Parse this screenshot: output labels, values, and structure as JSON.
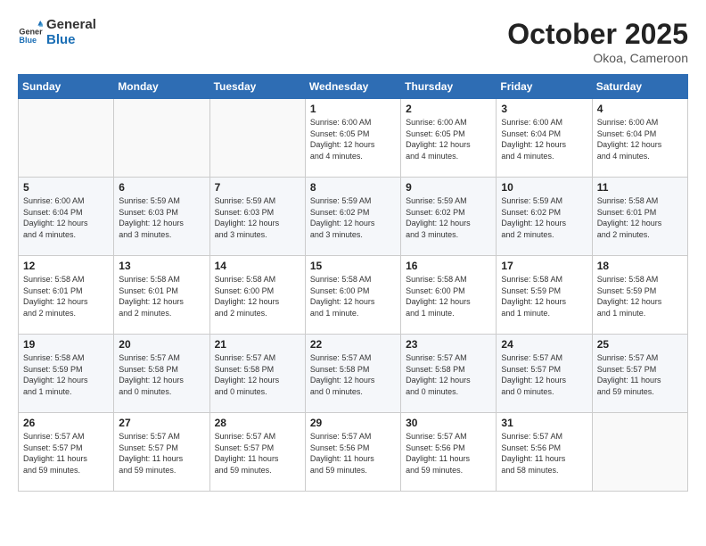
{
  "header": {
    "logo_line1": "General",
    "logo_line2": "Blue",
    "month_year": "October 2025",
    "location": "Okoa, Cameroon"
  },
  "weekdays": [
    "Sunday",
    "Monday",
    "Tuesday",
    "Wednesday",
    "Thursday",
    "Friday",
    "Saturday"
  ],
  "weeks": [
    [
      {
        "day": "",
        "info": ""
      },
      {
        "day": "",
        "info": ""
      },
      {
        "day": "",
        "info": ""
      },
      {
        "day": "1",
        "info": "Sunrise: 6:00 AM\nSunset: 6:05 PM\nDaylight: 12 hours\nand 4 minutes."
      },
      {
        "day": "2",
        "info": "Sunrise: 6:00 AM\nSunset: 6:05 PM\nDaylight: 12 hours\nand 4 minutes."
      },
      {
        "day": "3",
        "info": "Sunrise: 6:00 AM\nSunset: 6:04 PM\nDaylight: 12 hours\nand 4 minutes."
      },
      {
        "day": "4",
        "info": "Sunrise: 6:00 AM\nSunset: 6:04 PM\nDaylight: 12 hours\nand 4 minutes."
      }
    ],
    [
      {
        "day": "5",
        "info": "Sunrise: 6:00 AM\nSunset: 6:04 PM\nDaylight: 12 hours\nand 4 minutes."
      },
      {
        "day": "6",
        "info": "Sunrise: 5:59 AM\nSunset: 6:03 PM\nDaylight: 12 hours\nand 3 minutes."
      },
      {
        "day": "7",
        "info": "Sunrise: 5:59 AM\nSunset: 6:03 PM\nDaylight: 12 hours\nand 3 minutes."
      },
      {
        "day": "8",
        "info": "Sunrise: 5:59 AM\nSunset: 6:02 PM\nDaylight: 12 hours\nand 3 minutes."
      },
      {
        "day": "9",
        "info": "Sunrise: 5:59 AM\nSunset: 6:02 PM\nDaylight: 12 hours\nand 3 minutes."
      },
      {
        "day": "10",
        "info": "Sunrise: 5:59 AM\nSunset: 6:02 PM\nDaylight: 12 hours\nand 2 minutes."
      },
      {
        "day": "11",
        "info": "Sunrise: 5:58 AM\nSunset: 6:01 PM\nDaylight: 12 hours\nand 2 minutes."
      }
    ],
    [
      {
        "day": "12",
        "info": "Sunrise: 5:58 AM\nSunset: 6:01 PM\nDaylight: 12 hours\nand 2 minutes."
      },
      {
        "day": "13",
        "info": "Sunrise: 5:58 AM\nSunset: 6:01 PM\nDaylight: 12 hours\nand 2 minutes."
      },
      {
        "day": "14",
        "info": "Sunrise: 5:58 AM\nSunset: 6:00 PM\nDaylight: 12 hours\nand 2 minutes."
      },
      {
        "day": "15",
        "info": "Sunrise: 5:58 AM\nSunset: 6:00 PM\nDaylight: 12 hours\nand 1 minute."
      },
      {
        "day": "16",
        "info": "Sunrise: 5:58 AM\nSunset: 6:00 PM\nDaylight: 12 hours\nand 1 minute."
      },
      {
        "day": "17",
        "info": "Sunrise: 5:58 AM\nSunset: 5:59 PM\nDaylight: 12 hours\nand 1 minute."
      },
      {
        "day": "18",
        "info": "Sunrise: 5:58 AM\nSunset: 5:59 PM\nDaylight: 12 hours\nand 1 minute."
      }
    ],
    [
      {
        "day": "19",
        "info": "Sunrise: 5:58 AM\nSunset: 5:59 PM\nDaylight: 12 hours\nand 1 minute."
      },
      {
        "day": "20",
        "info": "Sunrise: 5:57 AM\nSunset: 5:58 PM\nDaylight: 12 hours\nand 0 minutes."
      },
      {
        "day": "21",
        "info": "Sunrise: 5:57 AM\nSunset: 5:58 PM\nDaylight: 12 hours\nand 0 minutes."
      },
      {
        "day": "22",
        "info": "Sunrise: 5:57 AM\nSunset: 5:58 PM\nDaylight: 12 hours\nand 0 minutes."
      },
      {
        "day": "23",
        "info": "Sunrise: 5:57 AM\nSunset: 5:58 PM\nDaylight: 12 hours\nand 0 minutes."
      },
      {
        "day": "24",
        "info": "Sunrise: 5:57 AM\nSunset: 5:57 PM\nDaylight: 12 hours\nand 0 minutes."
      },
      {
        "day": "25",
        "info": "Sunrise: 5:57 AM\nSunset: 5:57 PM\nDaylight: 11 hours\nand 59 minutes."
      }
    ],
    [
      {
        "day": "26",
        "info": "Sunrise: 5:57 AM\nSunset: 5:57 PM\nDaylight: 11 hours\nand 59 minutes."
      },
      {
        "day": "27",
        "info": "Sunrise: 5:57 AM\nSunset: 5:57 PM\nDaylight: 11 hours\nand 59 minutes."
      },
      {
        "day": "28",
        "info": "Sunrise: 5:57 AM\nSunset: 5:57 PM\nDaylight: 11 hours\nand 59 minutes."
      },
      {
        "day": "29",
        "info": "Sunrise: 5:57 AM\nSunset: 5:56 PM\nDaylight: 11 hours\nand 59 minutes."
      },
      {
        "day": "30",
        "info": "Sunrise: 5:57 AM\nSunset: 5:56 PM\nDaylight: 11 hours\nand 59 minutes."
      },
      {
        "day": "31",
        "info": "Sunrise: 5:57 AM\nSunset: 5:56 PM\nDaylight: 11 hours\nand 58 minutes."
      },
      {
        "day": "",
        "info": ""
      }
    ]
  ]
}
